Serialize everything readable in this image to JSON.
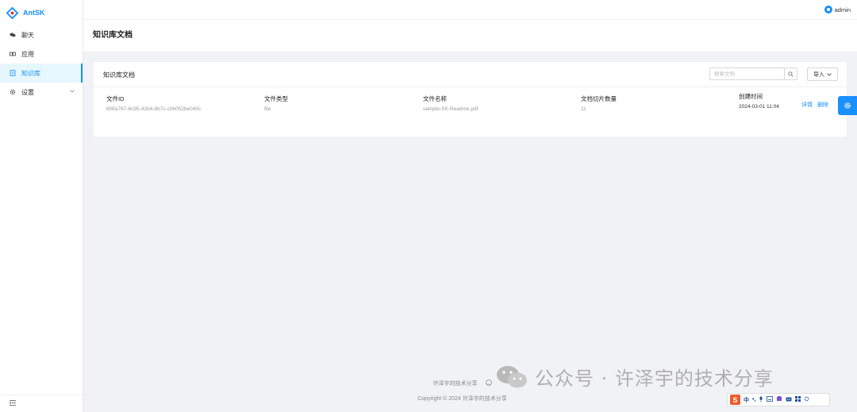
{
  "app": {
    "name": "AntSK"
  },
  "sidebar": {
    "items": [
      {
        "label": "聊天",
        "icon": "chat-icon"
      },
      {
        "label": "应用",
        "icon": "app-icon"
      },
      {
        "label": "知识库",
        "icon": "book-icon",
        "active": true
      },
      {
        "label": "设置",
        "icon": "gear-icon",
        "has_submenu": true
      }
    ],
    "collapse_icon": "menu-fold-icon"
  },
  "header": {
    "user": "admin"
  },
  "page": {
    "title": "知识库文档"
  },
  "card": {
    "title": "知识库文档",
    "search_placeholder": "搜索文档",
    "import_label": "导入",
    "columns": {
      "id_label": "文件ID",
      "type_label": "文件类型",
      "name_label": "文件名称",
      "count_label": "文档切片数量",
      "created_label": "创建时间"
    },
    "rows": [
      {
        "id": "6f4fa767-6c95-42b4-8b7c-c0b052be040c",
        "type": "file",
        "name": "sample-SK-Readme.pdf",
        "count": "11",
        "created": "2024-03-01 11:04",
        "detail": "详情",
        "delete": "删除"
      }
    ]
  },
  "footer": {
    "link1": "许泽宇的技术分享",
    "copyright": "Copyright © 2024 许泽宇的技术分享"
  },
  "watermark": {
    "text": "公众号 · 许泽宇的技术分享"
  },
  "ime": {
    "mode": "中",
    "symbol": "•,"
  },
  "colors": {
    "primary": "#1890ff",
    "background": "#f0f2f5"
  }
}
